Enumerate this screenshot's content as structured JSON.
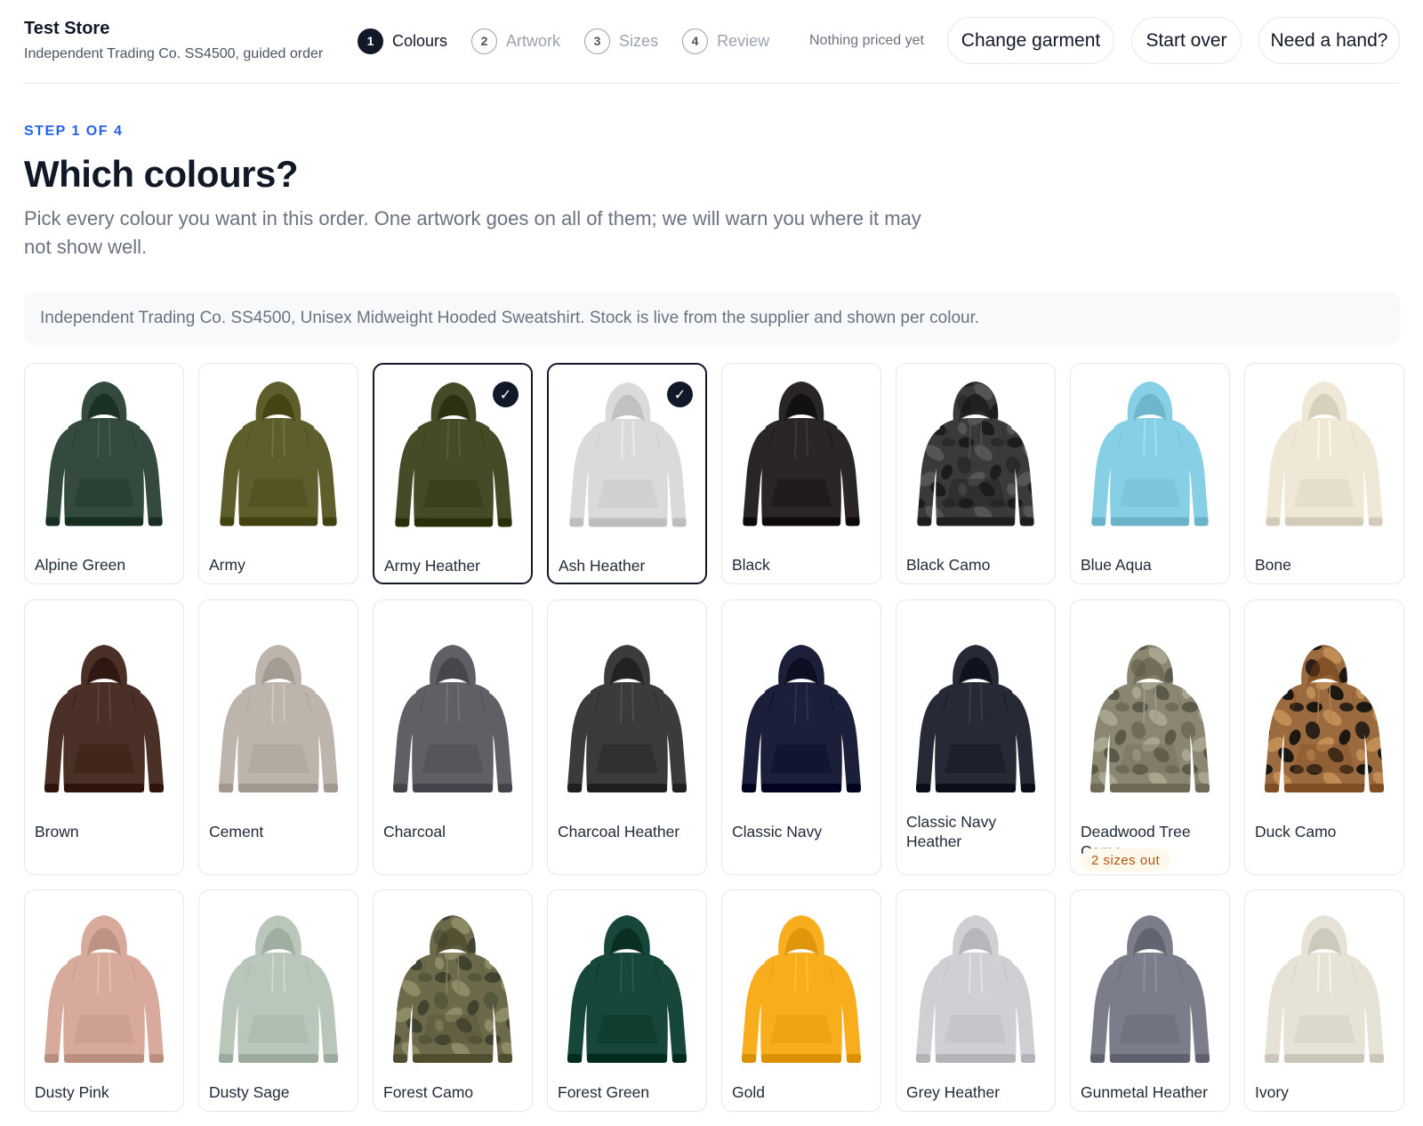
{
  "header": {
    "store_name": "Test Store",
    "store_sub": "Independent Trading Co. SS4500, guided order",
    "steps": [
      {
        "num": "1",
        "label": "Colours",
        "active": true
      },
      {
        "num": "2",
        "label": "Artwork",
        "active": false
      },
      {
        "num": "3",
        "label": "Sizes",
        "active": false
      },
      {
        "num": "4",
        "label": "Review",
        "active": false
      }
    ],
    "priced_label": "Nothing priced yet",
    "change_garment_label": "Change garment",
    "start_over_label": "Start over",
    "help_label": "Need a hand?"
  },
  "intro": {
    "eyebrow": "STEP 1 OF 4",
    "title": "Which colours?",
    "lead": "Pick every colour you want in this order. One artwork goes on all of them; we will warn you where it may not show well."
  },
  "info_text": "Independent Trading Co. SS4500, Unisex Midweight Hooded Sweatshirt. Stock is live from the supplier and shown per colour.",
  "check_glyph": "✓",
  "colours": [
    {
      "name": "Alpine Green",
      "color": "#344a3e",
      "pattern": "solid",
      "selected": false
    },
    {
      "name": "Army",
      "color": "#5d5e2c",
      "pattern": "solid",
      "selected": false
    },
    {
      "name": "Army Heather",
      "color": "#464a26",
      "pattern": "solid",
      "selected": true
    },
    {
      "name": "Ash Heather",
      "color": "#d9dadc",
      "pattern": "solid",
      "selected": true
    },
    {
      "name": "Black",
      "color": "#2a2527",
      "pattern": "solid",
      "selected": false
    },
    {
      "name": "Black Camo",
      "color": "#3a3a3a",
      "pattern": "camo-dark",
      "selected": false
    },
    {
      "name": "Blue Aqua",
      "color": "#86cfe4",
      "pattern": "solid",
      "selected": false
    },
    {
      "name": "Bone",
      "color": "#efe8d6",
      "pattern": "solid",
      "selected": false
    },
    {
      "name": "Brown",
      "color": "#4a3026",
      "pattern": "solid",
      "selected": false
    },
    {
      "name": "Cement",
      "color": "#bdb4ac",
      "pattern": "solid",
      "selected": false
    },
    {
      "name": "Charcoal",
      "color": "#5f6065",
      "pattern": "solid",
      "selected": false
    },
    {
      "name": "Charcoal Heather",
      "color": "#3c3a3d",
      "pattern": "solid",
      "selected": false
    },
    {
      "name": "Classic Navy",
      "color": "#1b1f3a",
      "pattern": "solid",
      "selected": false
    },
    {
      "name": "Classic Navy Heather",
      "color": "#252a36",
      "pattern": "solid",
      "selected": false
    },
    {
      "name": "Deadwood Tree Camo",
      "color": "#8a8672",
      "pattern": "tree-camo",
      "selected": false,
      "badge": "2 sizes out"
    },
    {
      "name": "Duck Camo",
      "color": "#9b6a3e",
      "pattern": "duck-camo",
      "selected": false
    },
    {
      "name": "Dusty Pink",
      "color": "#d7aa9c",
      "pattern": "solid",
      "selected": false
    },
    {
      "name": "Dusty Sage",
      "color": "#b9c6ba",
      "pattern": "solid",
      "selected": false
    },
    {
      "name": "Forest Camo",
      "color": "#6d6a4c",
      "pattern": "forest-camo",
      "selected": false
    },
    {
      "name": "Forest Green",
      "color": "#17473a",
      "pattern": "solid",
      "selected": false
    },
    {
      "name": "Gold",
      "color": "#f8ae1c",
      "pattern": "solid",
      "selected": false
    },
    {
      "name": "Grey Heather",
      "color": "#cfd0d3",
      "pattern": "solid",
      "selected": false
    },
    {
      "name": "Gunmetal Heather",
      "color": "#7b7d8a",
      "pattern": "solid",
      "selected": false
    },
    {
      "name": "Ivory",
      "color": "#e6e2d6",
      "pattern": "solid",
      "selected": false
    }
  ]
}
